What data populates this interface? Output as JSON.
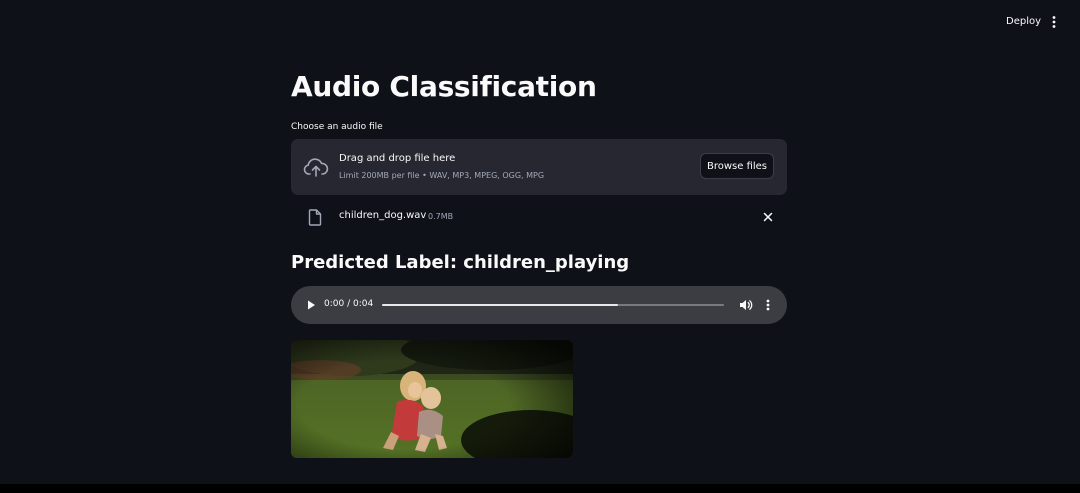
{
  "header": {
    "deploy_label": "Deploy",
    "menu_icon": "kebab-vertical-icon"
  },
  "main": {
    "title": "Audio Classification",
    "uploader": {
      "label": "Choose an audio file",
      "dropzone_title": "Drag and drop file here",
      "dropzone_subtitle": "Limit 200MB per file • WAV, MP3, MPEG, OGG, MPG",
      "browse_label": "Browse files",
      "icon": "cloud-upload-icon"
    },
    "uploaded_file": {
      "name": "children_dog.wav",
      "size": "0.7MB",
      "icon": "file-icon",
      "remove_icon": "close-icon"
    },
    "prediction": "Predicted Label: children_playing",
    "audio": {
      "time": "0:00 / 0:04",
      "progress": 0.69
    },
    "image_subject": "children playing on grass"
  },
  "colors": {
    "background": "#0e1117",
    "surface": "#262730",
    "text": "#fafafa",
    "muted": "#a3a8b8",
    "player": "#3b3d42"
  }
}
